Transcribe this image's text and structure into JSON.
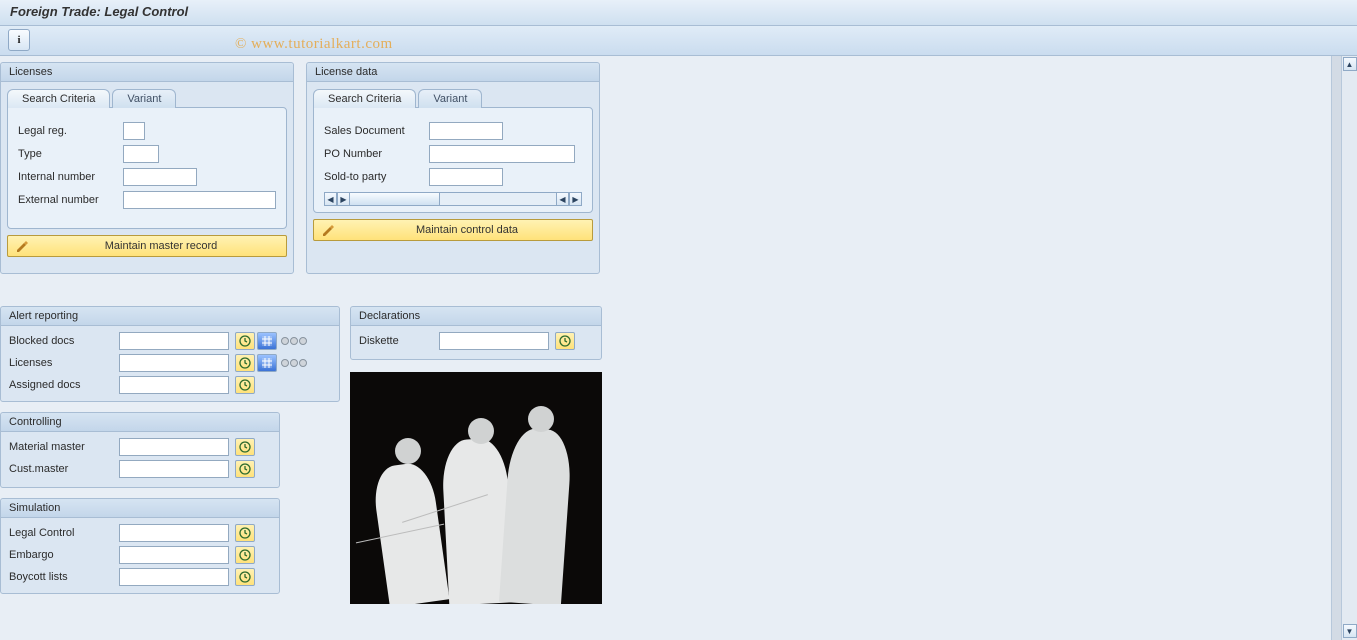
{
  "title": "Foreign Trade: Legal Control",
  "watermark": "© www.tutorialkart.com",
  "toolbar": {
    "info_icon": "i"
  },
  "tabs": {
    "search_criteria": "Search Criteria",
    "variant": "Variant"
  },
  "licenses": {
    "title": "Licenses",
    "fields": {
      "legal_reg": "Legal reg.",
      "type": "Type",
      "internal_number": "Internal number",
      "external_number": "External number"
    },
    "maintain_button": "Maintain master record"
  },
  "license_data": {
    "title": "License data",
    "fields": {
      "sales_document": "Sales Document",
      "po_number": "PO Number",
      "sold_to_party": "Sold-to party"
    },
    "maintain_button": "Maintain control data"
  },
  "alert_reporting": {
    "title": "Alert reporting",
    "rows": {
      "blocked_docs": "Blocked docs",
      "licenses": "Licenses",
      "assigned_docs": "Assigned docs"
    }
  },
  "controlling": {
    "title": "Controlling",
    "rows": {
      "material_master": "Material master",
      "cust_master": "Cust.master"
    }
  },
  "simulation": {
    "title": "Simulation",
    "rows": {
      "legal_control": "Legal Control",
      "embargo": "Embargo",
      "boycott_lists": "Boycott lists"
    }
  },
  "declarations": {
    "title": "Declarations",
    "rows": {
      "diskette": "Diskette"
    }
  }
}
